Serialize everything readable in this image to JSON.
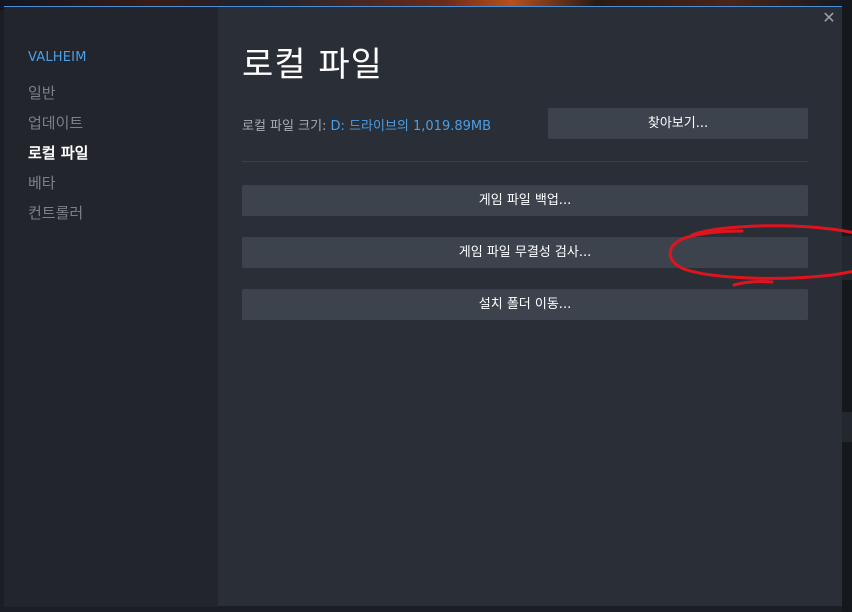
{
  "sidebar": {
    "game_title": "VALHEIM",
    "items": [
      {
        "label": "일반",
        "active": false
      },
      {
        "label": "업데이트",
        "active": false
      },
      {
        "label": "로컬 파일",
        "active": true
      },
      {
        "label": "베타",
        "active": false
      },
      {
        "label": "컨트롤러",
        "active": false
      }
    ]
  },
  "window": {
    "close_icon": "close-icon",
    "close_glyph": "✕"
  },
  "main": {
    "title": "로컬 파일",
    "size_label": "로컬 파일 크기:",
    "size_value": "D: 드라이브의 1,019.89MB",
    "browse_label": "찾아보기...",
    "buttons": {
      "backup": "게임 파일 백업...",
      "verify": "게임 파일 무결성 검사...",
      "move": "설치 폴더 이동..."
    }
  },
  "colors": {
    "accent": "#4a9fe8",
    "annotation": "#e0141e"
  }
}
